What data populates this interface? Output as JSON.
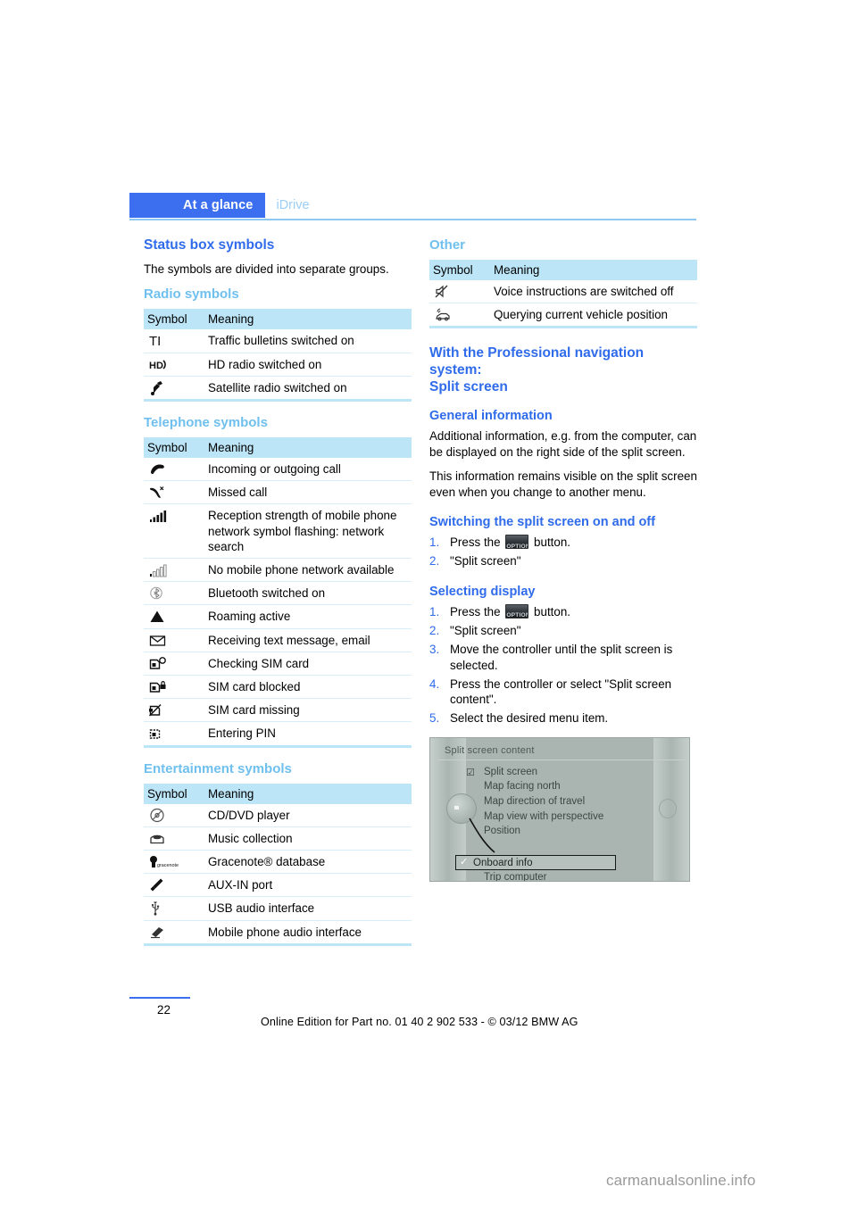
{
  "header": {
    "chapter_tab": "At a glance",
    "section_tab": "iDrive",
    "accent_blue": "#3c6ff0",
    "light_blue": "#9ccdf5"
  },
  "left_column": {
    "title": "Status box symbols",
    "intro": "The symbols are divided into separate groups.",
    "sections": [
      {
        "heading": "Radio symbols",
        "columns": [
          "Symbol",
          "Meaning"
        ],
        "rows": [
          {
            "icon": "traffic-info-ti-icon",
            "meaning": "Traffic bulletins switched on"
          },
          {
            "icon": "hd-radio-icon",
            "meaning": "HD radio switched on"
          },
          {
            "icon": "satellite-radio-icon",
            "meaning": "Satellite radio switched on"
          }
        ]
      },
      {
        "heading": "Telephone symbols",
        "columns": [
          "Symbol",
          "Meaning"
        ],
        "rows": [
          {
            "icon": "handset-active-call-icon",
            "meaning": "Incoming or outgoing call"
          },
          {
            "icon": "missed-call-icon",
            "meaning": "Missed call"
          },
          {
            "icon": "signal-bars-full-icon",
            "meaning": "Reception strength of mobile phone network symbol flashing: network search"
          },
          {
            "icon": "signal-bars-empty-icon",
            "meaning": "No mobile phone network available"
          },
          {
            "icon": "bluetooth-icon",
            "meaning": "Bluetooth switched on"
          },
          {
            "icon": "roaming-triangle-icon",
            "meaning": "Roaming active"
          },
          {
            "icon": "envelope-icon",
            "meaning": "Receiving text message, email"
          },
          {
            "icon": "sim-card-checking-icon",
            "meaning": "Checking SIM card"
          },
          {
            "icon": "sim-card-blocked-icon",
            "meaning": "SIM card blocked"
          },
          {
            "icon": "sim-card-missing-icon",
            "meaning": "SIM card missing"
          },
          {
            "icon": "sim-card-pin-icon",
            "meaning": "Entering PIN"
          }
        ]
      },
      {
        "heading": "Entertainment symbols",
        "columns": [
          "Symbol",
          "Meaning"
        ],
        "rows": [
          {
            "icon": "cd-dvd-player-icon",
            "meaning": "CD/DVD player"
          },
          {
            "icon": "music-collection-icon",
            "meaning": "Music collection"
          },
          {
            "icon": "gracenote-icon",
            "meaning": "Gracenote® database"
          },
          {
            "icon": "aux-in-plug-icon",
            "meaning": "AUX-IN port"
          },
          {
            "icon": "usb-icon",
            "meaning": "USB audio interface"
          },
          {
            "icon": "mobile-phone-audio-icon",
            "meaning": "Mobile phone audio interface"
          }
        ]
      }
    ]
  },
  "right_column": {
    "other_section": {
      "heading": "Other",
      "columns": [
        "Symbol",
        "Meaning"
      ],
      "rows": [
        {
          "icon": "voice-muted-icon",
          "meaning": "Voice instructions are switched off"
        },
        {
          "icon": "vehicle-position-icon",
          "meaning": "Querying current vehicle position"
        }
      ]
    },
    "main_heading": "With the Professional navigation system:\nSplit screen",
    "general_information": {
      "heading": "General information",
      "paragraph_1": "Additional information, e.g. from the computer, can be displayed on the right side of the split screen.",
      "paragraph_2": "This information remains visible on the split screen even when you change to another menu."
    },
    "switching": {
      "heading": "Switching the split screen on and off",
      "steps": [
        {
          "num": "1.",
          "before": "Press the",
          "button": "OPTION",
          "after": "button."
        },
        {
          "num": "2.",
          "text": "\"Split screen\""
        }
      ]
    },
    "selecting_display": {
      "heading": "Selecting display",
      "steps": [
        {
          "num": "1.",
          "before": "Press the",
          "button": "OPTION",
          "after": "button."
        },
        {
          "num": "2.",
          "text": "\"Split screen\""
        },
        {
          "num": "3.",
          "text": "Move the controller until the split screen is selected."
        },
        {
          "num": "4.",
          "text": "Press the controller or select \"Split screen content\"."
        },
        {
          "num": "5.",
          "text": "Select the desired menu item."
        }
      ]
    },
    "idrive_screen": {
      "title": "Split screen content",
      "items": [
        {
          "label": "Split screen",
          "checked": true,
          "highlighted": false
        },
        {
          "label": "Map facing north",
          "checked": false,
          "highlighted": false
        },
        {
          "label": "Map direction of travel",
          "checked": false,
          "highlighted": false
        },
        {
          "label": "Map view with perspective",
          "checked": false,
          "highlighted": false
        },
        {
          "label": "Position",
          "checked": false,
          "highlighted": false
        }
      ],
      "highlighted_item": {
        "label": "Onboard info",
        "checked": true
      },
      "last_item": {
        "label": "Trip computer"
      }
    }
  },
  "footer": {
    "page_number": "22",
    "edition_line": "Online Edition for Part no. 01 40 2 902 533 - © 03/12 BMW AG",
    "watermark": "carmanualsonline.info"
  }
}
